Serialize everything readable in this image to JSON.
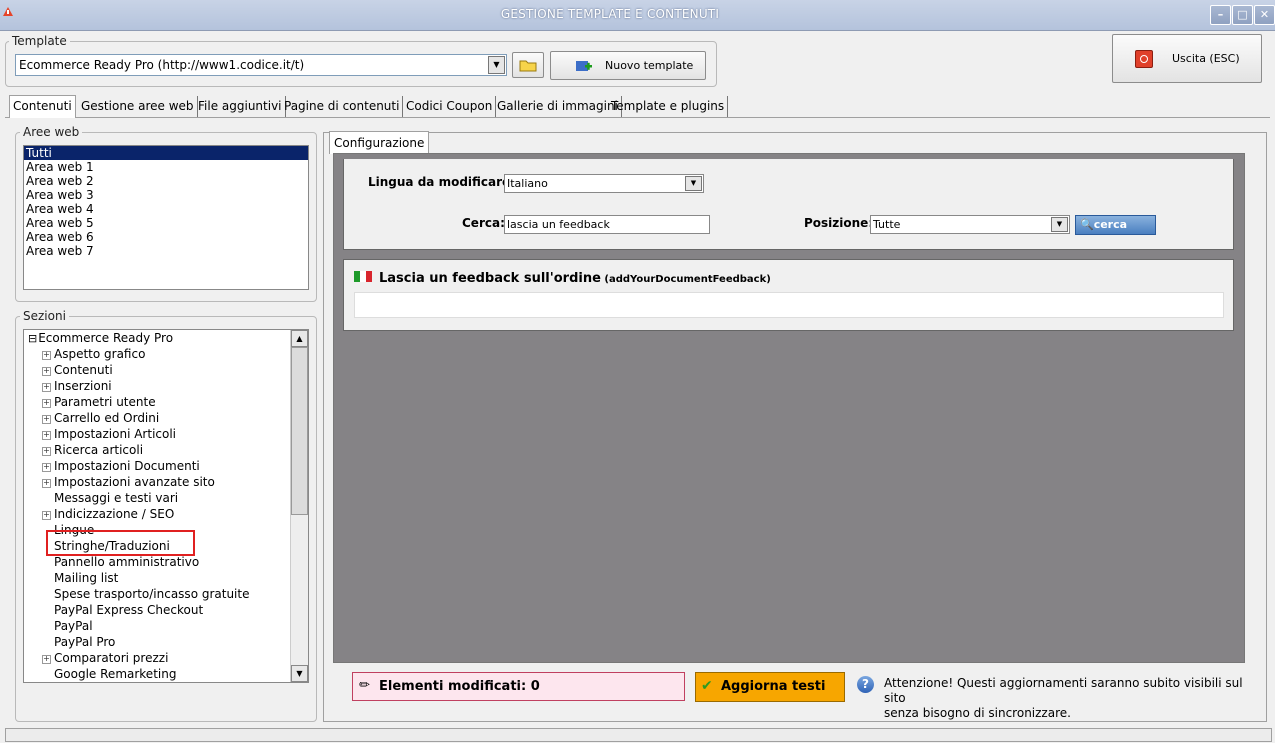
{
  "window": {
    "title": "GESTIONE TEMPLATE E CONTENUTI"
  },
  "template": {
    "group_label": "Template",
    "selected": "Ecommerce Ready Pro (http://www1.codice.it/t)",
    "new_button": "Nuovo template"
  },
  "exit_button": "Uscita (ESC)",
  "tabs": [
    "Contenuti",
    "Gestione aree web",
    "File aggiuntivi",
    "Pagine di contenuti",
    "Codici Coupon",
    "Gallerie di immagini",
    "Template e plugins"
  ],
  "aree_web": {
    "label": "Aree web",
    "items": [
      "Tutti",
      "Area web 1",
      "Area web 2",
      "Area web 3",
      "Area web 4",
      "Area web 5",
      "Area web 6",
      "Area web 7"
    ],
    "selected_index": 0
  },
  "sezioni": {
    "label": "Sezioni",
    "root": "Ecommerce Ready Pro",
    "items": [
      {
        "label": "Aspetto grafico",
        "expandable": true
      },
      {
        "label": "Contenuti",
        "expandable": true
      },
      {
        "label": "Inserzioni",
        "expandable": true
      },
      {
        "label": "Parametri utente",
        "expandable": true
      },
      {
        "label": "Carrello ed Ordini",
        "expandable": true
      },
      {
        "label": "Impostazioni Articoli",
        "expandable": true
      },
      {
        "label": "Ricerca articoli",
        "expandable": true
      },
      {
        "label": "Impostazioni Documenti",
        "expandable": true
      },
      {
        "label": "Impostazioni avanzate sito",
        "expandable": true
      },
      {
        "label": "Messaggi e testi vari",
        "expandable": false
      },
      {
        "label": "Indicizzazione / SEO",
        "expandable": true
      },
      {
        "label": "Lingue",
        "expandable": false
      },
      {
        "label": "Stringhe/Traduzioni",
        "expandable": false
      },
      {
        "label": "Pannello amministrativo",
        "expandable": false
      },
      {
        "label": "Mailing list",
        "expandable": false
      },
      {
        "label": "Spese trasporto/incasso gratuite",
        "expandable": false
      },
      {
        "label": "PayPal Express Checkout",
        "expandable": false
      },
      {
        "label": "PayPal",
        "expandable": false
      },
      {
        "label": "PayPal Pro",
        "expandable": false
      },
      {
        "label": "Comparatori prezzi",
        "expandable": true
      },
      {
        "label": "Google Remarketing",
        "expandable": false
      }
    ],
    "highlighted": "Stringhe/Traduzioni"
  },
  "config": {
    "tab": "Configurazione",
    "lingua_label": "Lingua da modificare:",
    "lingua_value": "Italiano",
    "cerca_label": "Cerca:",
    "cerca_value": "lascia un feedback",
    "posizione_label": "Posizione:",
    "posizione_value": "Tutte",
    "search_button": "cerca"
  },
  "result": {
    "title": "Lascia un feedback sull'ordine",
    "key": "(addYourDocumentFeedback)",
    "value": ""
  },
  "footer": {
    "modified": "Elementi modificati: 0",
    "update_button": "Aggiorna testi",
    "notice_line1": "Attenzione! Questi aggiornamenti saranno subito visibili sul sito",
    "notice_line2": "senza bisogno di sincronizzare."
  },
  "colors": {
    "selection": "#0a246a",
    "gray_panel": "#858386",
    "orange": "#f7a600",
    "highlight_box": "#e02020"
  }
}
